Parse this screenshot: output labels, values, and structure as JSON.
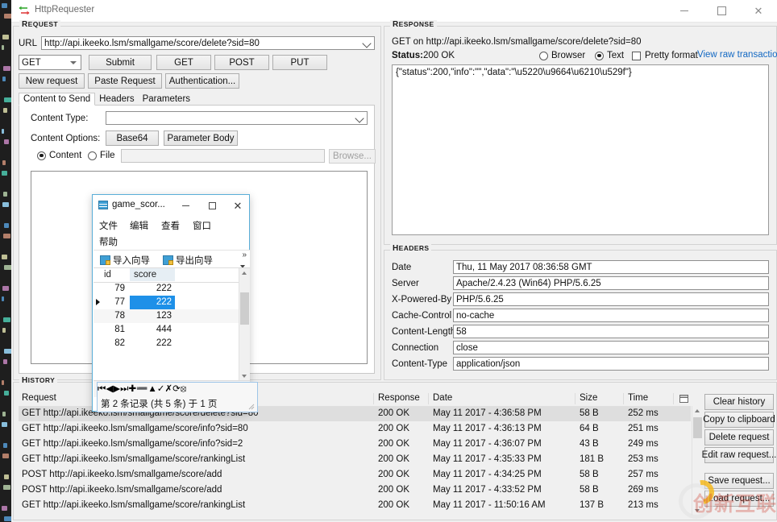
{
  "window": {
    "title": "HttpRequester",
    "controls": {
      "minimize": "–",
      "maximize": "□",
      "close": "✕"
    }
  },
  "request": {
    "group_label": "Request",
    "url_label": "URL",
    "url_value": "http://api.ikeeko.lsm/smallgame/score/delete?sid=80",
    "method_value": "GET",
    "buttons": {
      "submit": "Submit",
      "get": "GET",
      "post": "POST",
      "put": "PUT",
      "new_request": "New request",
      "paste_request": "Paste Request",
      "authentication": "Authentication..."
    },
    "tabs": [
      {
        "label": "Content to Send",
        "selected": true
      },
      {
        "label": "Headers",
        "selected": false
      },
      {
        "label": "Parameters",
        "selected": false
      }
    ],
    "content": {
      "content_type_label": "Content Type:",
      "content_type_value": "",
      "content_options_label": "Content Options:",
      "base64_button": "Base64",
      "parameter_body_button": "Parameter Body",
      "radio_content": "Content",
      "radio_file": "File",
      "file_path_value": "",
      "browse_button": "Browse...",
      "body_value": ""
    }
  },
  "response": {
    "group_label": "Response",
    "request_line": "GET on http://api.ikeeko.lsm/smallgame/score/delete?sid=80",
    "status_label": "Status:",
    "status_value": "200 OK",
    "view_browser": "Browser",
    "view_text": "Text",
    "pretty_format": "Pretty format",
    "view_raw_link": "View raw transaction",
    "body": "{\"status\":200,\"info\":\"\",\"data\":\"\\u5220\\u9664\\u6210\\u529f\"}"
  },
  "headers": {
    "group_label": "Headers",
    "rows": [
      {
        "name": "Date",
        "value": "Thu, 11 May 2017 08:36:58 GMT"
      },
      {
        "name": "Server",
        "value": "Apache/2.4.23 (Win64) PHP/5.6.25"
      },
      {
        "name": "X-Powered-By",
        "value": "PHP/5.6.25"
      },
      {
        "name": "Cache-Control",
        "value": "no-cache"
      },
      {
        "name": "Content-Length",
        "value": "58"
      },
      {
        "name": "Connection",
        "value": "close"
      },
      {
        "name": "Content-Type",
        "value": "application/json"
      }
    ]
  },
  "history": {
    "group_label": "History",
    "columns": [
      "Request",
      "Response",
      "Date",
      "Size",
      "Time"
    ],
    "rows": [
      {
        "request": "GET http://api.ikeeko.lsm/smallgame/score/delete?sid=80",
        "response": "200 OK",
        "date": "May 11 2017 - 4:36:58 PM",
        "size": "58 B",
        "time": "252 ms",
        "selected": true
      },
      {
        "request": "GET http://api.ikeeko.lsm/smallgame/score/info?sid=80",
        "response": "200 OK",
        "date": "May 11 2017 - 4:36:13 PM",
        "size": "64 B",
        "time": "251 ms",
        "selected": false
      },
      {
        "request": "GET http://api.ikeeko.lsm/smallgame/score/info?sid=2",
        "response": "200 OK",
        "date": "May 11 2017 - 4:36:07 PM",
        "size": "43 B",
        "time": "249 ms",
        "selected": false
      },
      {
        "request": "GET http://api.ikeeko.lsm/smallgame/score/rankingList",
        "response": "200 OK",
        "date": "May 11 2017 - 4:35:33 PM",
        "size": "181 B",
        "time": "253 ms",
        "selected": false
      },
      {
        "request": "POST http://api.ikeeko.lsm/smallgame/score/add",
        "response": "200 OK",
        "date": "May 11 2017 - 4:34:25 PM",
        "size": "58 B",
        "time": "257 ms",
        "selected": false
      },
      {
        "request": "POST http://api.ikeeko.lsm/smallgame/score/add",
        "response": "200 OK",
        "date": "May 11 2017 - 4:33:52 PM",
        "size": "58 B",
        "time": "269 ms",
        "selected": false
      },
      {
        "request": "GET http://api.ikeeko.lsm/smallgame/score/rankingList",
        "response": "200 OK",
        "date": "May 11 2017 - 11:50:16 AM",
        "size": "137 B",
        "time": "213 ms",
        "selected": false
      }
    ],
    "buttons": [
      "Clear history",
      "Copy to clipboard",
      "Delete request",
      "Edit raw request...",
      "Save request...",
      "Load request..."
    ]
  },
  "child_window": {
    "title": "game_scor...",
    "controls": {
      "minimize": "–",
      "maximize": "□",
      "close": "✕"
    },
    "menu": [
      "文件",
      "编辑",
      "查看",
      "窗口",
      "帮助"
    ],
    "toolbar": [
      "导入向导",
      "导出向导"
    ],
    "toolbar_overflow": "»",
    "grid": {
      "columns": [
        "id",
        "score"
      ],
      "rows": [
        {
          "id": "79",
          "score": "222",
          "selected": false,
          "current": false
        },
        {
          "id": "77",
          "score": "222",
          "selected": true,
          "current": true
        },
        {
          "id": "78",
          "score": "123",
          "selected": false,
          "current": false
        },
        {
          "id": "81",
          "score": "444",
          "selected": false,
          "current": false
        },
        {
          "id": "82",
          "score": "222",
          "selected": false,
          "current": false
        }
      ]
    },
    "nav_buttons": [
      "⏮",
      "◀",
      "▶",
      "⏭",
      "✚",
      "➖",
      "▲",
      "✓",
      "✗",
      "⟳",
      "⦻"
    ],
    "status": "第 2 条记录 (共 5 条) 于 1 页"
  },
  "watermark": {
    "text": "创新互联"
  },
  "colors": {
    "accent_blue": "#1e90e8",
    "link_blue": "#1268c3",
    "window_bg": "#f0f0f0",
    "child_border": "#5aaed8",
    "selection_gray": "#dedede"
  }
}
